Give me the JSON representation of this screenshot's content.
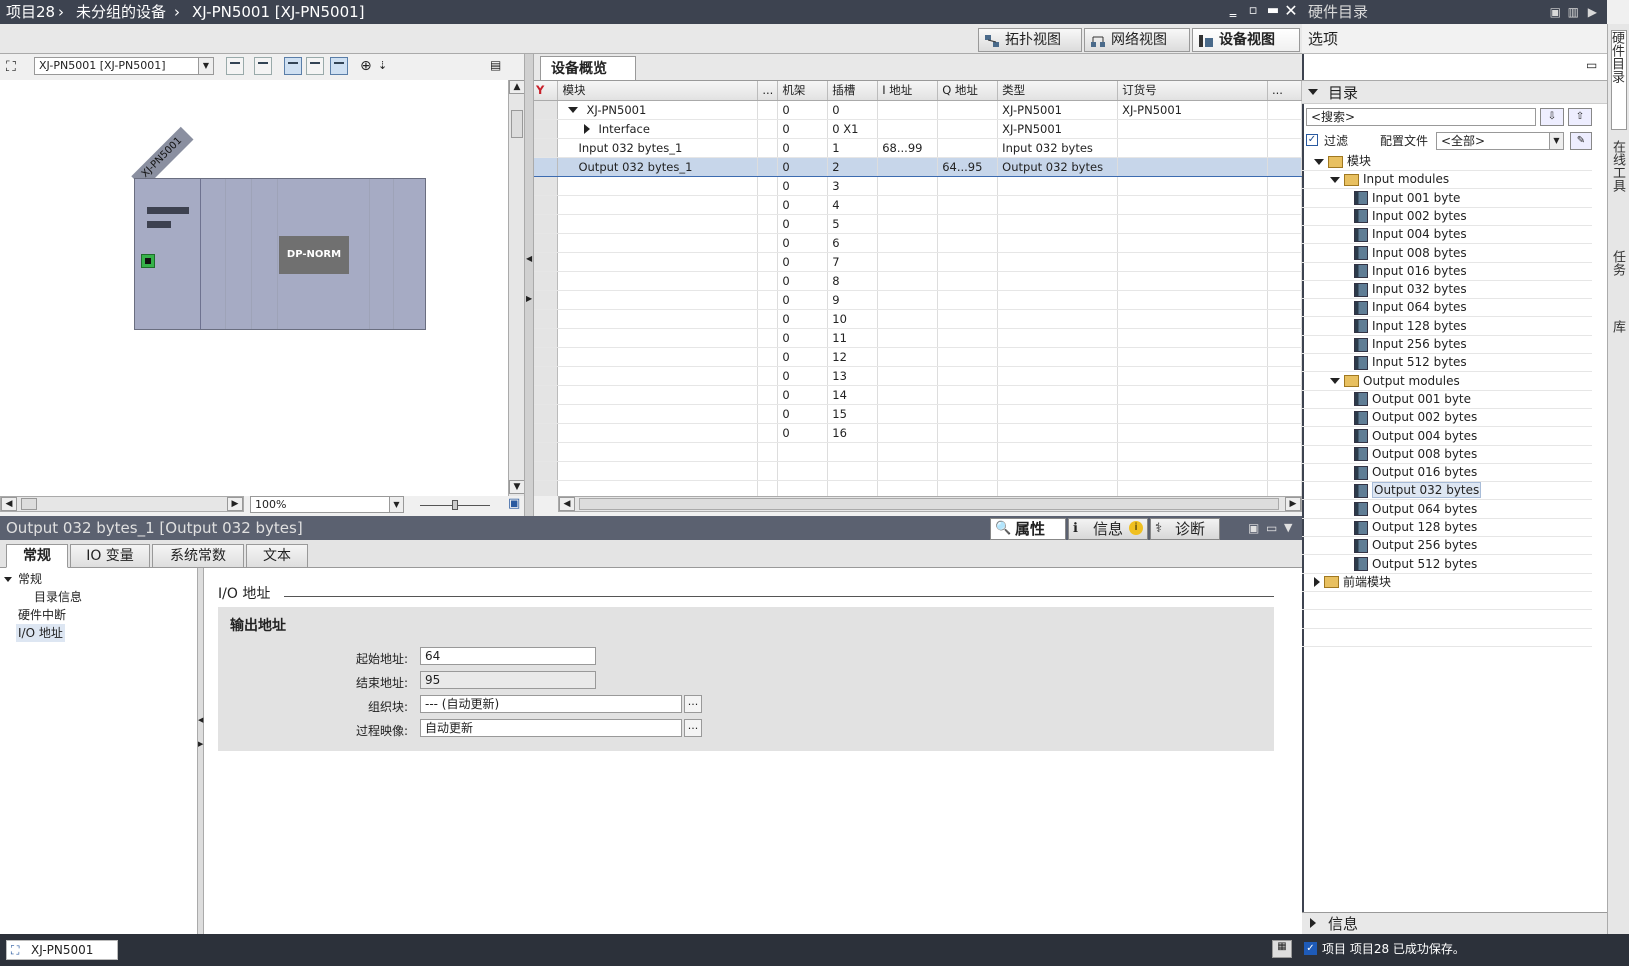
{
  "window": {
    "breadcrumb": [
      "项目28",
      "未分组的设备",
      "XJ-PN5001 [XJ-PN5001]"
    ],
    "controls": [
      "minimize",
      "restore",
      "maximize",
      "close"
    ]
  },
  "view_tabs": [
    {
      "label": "拓扑视图",
      "icon": "topology-icon"
    },
    {
      "label": "网络视图",
      "icon": "network-icon"
    },
    {
      "label": "设备视图",
      "icon": "device-icon",
      "active": true
    }
  ],
  "graphic_toolbar": {
    "device_select": "XJ-PN5001 [XJ-PN5001]",
    "zoom": "100%"
  },
  "canvas": {
    "device_label": "XJ-PN5001",
    "module_label": "DP-NORM"
  },
  "overview": {
    "tab": "设备概览",
    "columns": [
      "模块",
      "...",
      "机架",
      "插槽",
      "I 地址",
      "Q 地址",
      "类型",
      "订货号",
      "..."
    ],
    "rows": [
      {
        "module": "XJ-PN5001",
        "expand": "down",
        "rack": "0",
        "slot": "0",
        "i_addr": "",
        "q_addr": "",
        "type": "XJ-PN5001",
        "order": "XJ-PN5001"
      },
      {
        "module": "Interface",
        "expand": "right",
        "rack": "0",
        "slot": "0 X1",
        "i_addr": "",
        "q_addr": "",
        "type": "XJ-PN5001",
        "order": ""
      },
      {
        "module": "Input 032 bytes_1",
        "expand": "",
        "rack": "0",
        "slot": "1",
        "i_addr": "68...99",
        "q_addr": "",
        "type": "Input 032 bytes",
        "order": ""
      },
      {
        "module": "Output 032 bytes_1",
        "expand": "",
        "rack": "0",
        "slot": "2",
        "i_addr": "",
        "q_addr": "64...95",
        "type": "Output 032 bytes",
        "order": "",
        "selected": true
      },
      {
        "module": "",
        "expand": "",
        "rack": "0",
        "slot": "3",
        "i_addr": "",
        "q_addr": "",
        "type": "",
        "order": ""
      },
      {
        "module": "",
        "expand": "",
        "rack": "0",
        "slot": "4",
        "i_addr": "",
        "q_addr": "",
        "type": "",
        "order": ""
      },
      {
        "module": "",
        "expand": "",
        "rack": "0",
        "slot": "5",
        "i_addr": "",
        "q_addr": "",
        "type": "",
        "order": ""
      },
      {
        "module": "",
        "expand": "",
        "rack": "0",
        "slot": "6",
        "i_addr": "",
        "q_addr": "",
        "type": "",
        "order": ""
      },
      {
        "module": "",
        "expand": "",
        "rack": "0",
        "slot": "7",
        "i_addr": "",
        "q_addr": "",
        "type": "",
        "order": ""
      },
      {
        "module": "",
        "expand": "",
        "rack": "0",
        "slot": "8",
        "i_addr": "",
        "q_addr": "",
        "type": "",
        "order": ""
      },
      {
        "module": "",
        "expand": "",
        "rack": "0",
        "slot": "9",
        "i_addr": "",
        "q_addr": "",
        "type": "",
        "order": ""
      },
      {
        "module": "",
        "expand": "",
        "rack": "0",
        "slot": "10",
        "i_addr": "",
        "q_addr": "",
        "type": "",
        "order": ""
      },
      {
        "module": "",
        "expand": "",
        "rack": "0",
        "slot": "11",
        "i_addr": "",
        "q_addr": "",
        "type": "",
        "order": ""
      },
      {
        "module": "",
        "expand": "",
        "rack": "0",
        "slot": "12",
        "i_addr": "",
        "q_addr": "",
        "type": "",
        "order": ""
      },
      {
        "module": "",
        "expand": "",
        "rack": "0",
        "slot": "13",
        "i_addr": "",
        "q_addr": "",
        "type": "",
        "order": ""
      },
      {
        "module": "",
        "expand": "",
        "rack": "0",
        "slot": "14",
        "i_addr": "",
        "q_addr": "",
        "type": "",
        "order": ""
      },
      {
        "module": "",
        "expand": "",
        "rack": "0",
        "slot": "15",
        "i_addr": "",
        "q_addr": "",
        "type": "",
        "order": ""
      },
      {
        "module": "",
        "expand": "",
        "rack": "0",
        "slot": "16",
        "i_addr": "",
        "q_addr": "",
        "type": "",
        "order": ""
      }
    ]
  },
  "properties": {
    "title": "Output 032 bytes_1 [Output 032 bytes]",
    "tabs": [
      "属性",
      "信息",
      "诊断"
    ],
    "subtabs": [
      "常规",
      "IO 变量",
      "系统常数",
      "文本"
    ],
    "nav": [
      "常规",
      "目录信息",
      "硬件中断",
      "I/O 地址"
    ],
    "section": "I/O 地址",
    "group": "输出地址",
    "fields": [
      {
        "label": "起始地址:",
        "value": "64"
      },
      {
        "label": "结束地址:",
        "value": "95"
      },
      {
        "label": "组织块:",
        "value": "--- (自动更新)"
      },
      {
        "label": "过程映像:",
        "value": "自动更新"
      }
    ]
  },
  "catalog": {
    "title": "硬件目录",
    "options": "选项",
    "directory": "目录",
    "search_placeholder": "<搜索>",
    "filter_label": "过滤",
    "profile_label": "配置文件",
    "profile_value": "<全部>",
    "root": "模块",
    "input_folder": "Input modules",
    "inputs": [
      "Input 001 byte",
      "Input 002 bytes",
      "Input 004 bytes",
      "Input 008 bytes",
      "Input 016 bytes",
      "Input 032 bytes",
      "Input 064 bytes",
      "Input 128 bytes",
      "Input 256 bytes",
      "Input 512 bytes"
    ],
    "output_folder": "Output modules",
    "outputs": [
      "Output 001 byte",
      "Output 002 bytes",
      "Output 004 bytes",
      "Output 008 bytes",
      "Output 016 bytes",
      "Output 032 bytes",
      "Output 064 bytes",
      "Output 128 bytes",
      "Output 256 bytes",
      "Output 512 bytes"
    ],
    "front_modules": "前端模块",
    "info": "信息"
  },
  "side_tabs": [
    "硬件目录",
    "在线工具",
    "任务",
    "库"
  ],
  "status": {
    "device_tab": "XJ-PN5001",
    "message": "项目 项目28 已成功保存。"
  },
  "colors": {
    "titlebar": "#3d4350",
    "selection": "#c7d6ea",
    "module": "#a6abc4"
  }
}
